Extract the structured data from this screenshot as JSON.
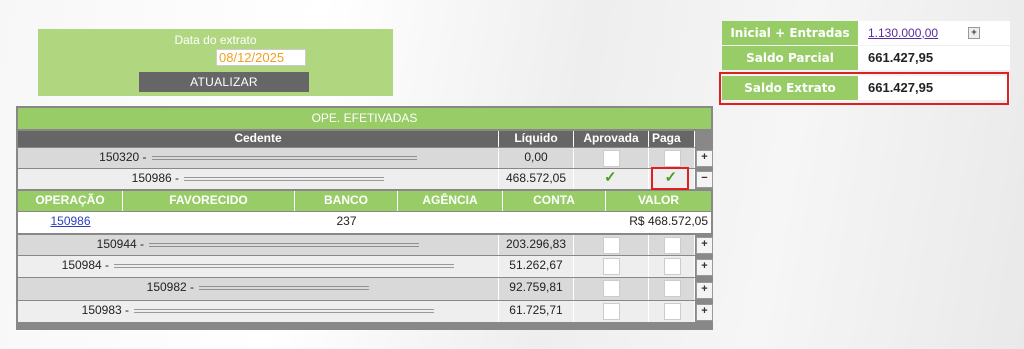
{
  "extract": {
    "label": "Data do extrato",
    "date": "08/12/2025",
    "update_button": "ATUALIZAR"
  },
  "summary": {
    "rows": [
      {
        "label": "Inicial + Entradas",
        "value": "1.130.000,00",
        "is_link": true
      },
      {
        "label": "Saldo Parcial",
        "value": "661.427,95"
      },
      {
        "label": "Saldo Extrato",
        "value": "661.427,95"
      }
    ],
    "expand_icon": "+"
  },
  "grid": {
    "title": "OPE. EFETIVADAS",
    "headers": {
      "cedente": "Cedente",
      "liquido": "Líquido",
      "aprovada": "Aprovada",
      "paga": "Paga"
    },
    "rows": [
      {
        "prefix": "150320 - ",
        "value": "0,00",
        "aprovada": false,
        "paga": false,
        "button": "+"
      },
      {
        "prefix": "150986 - ",
        "value": "468.572,05",
        "aprovada": true,
        "paga": true,
        "button": "−"
      },
      {
        "prefix": "150944 - ",
        "value": "203.296,83",
        "aprovada": false,
        "paga": false,
        "button": "+"
      },
      {
        "prefix": "150984 - ",
        "value": "51.262,67",
        "aprovada": false,
        "paga": false,
        "button": "+"
      },
      {
        "prefix": "150982 - ",
        "value": "92.759,81",
        "aprovada": false,
        "paga": false,
        "button": "+"
      },
      {
        "prefix": "150983 - ",
        "value": "61.725,71",
        "aprovada": false,
        "paga": false,
        "button": "+"
      }
    ],
    "detail": {
      "headers": {
        "operacao": "OPERAÇÃO",
        "favorecido": "FAVORECIDO",
        "banco": "BANCO",
        "agencia": "AGÊNCIA",
        "conta": "CONTA",
        "valor": "VALOR"
      },
      "row": {
        "operacao": "150986",
        "favorecido": "",
        "banco": "237",
        "agencia": "",
        "conta": "",
        "valor": "R$ 468.572,05"
      }
    }
  }
}
